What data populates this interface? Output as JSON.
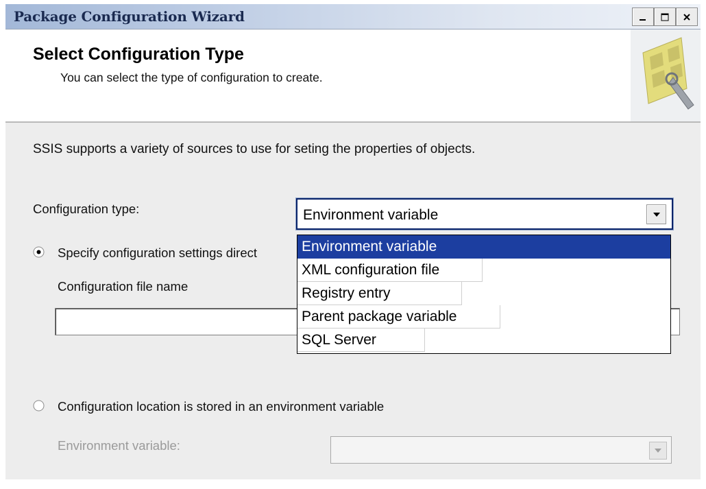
{
  "window": {
    "title": "Package Configuration Wizard"
  },
  "header": {
    "title": "Select Configuration Type",
    "subtitle": "You can select the type of configuration to create."
  },
  "body": {
    "description": "SSIS supports a variety of sources to use for seting the properties of objects.",
    "config_type_label": "Configuration type:",
    "config_type_value": "Environment variable",
    "dropdown_options": [
      "Environment variable",
      "XML configuration file",
      "Registry entry",
      "Parent package variable",
      "SQL Server"
    ],
    "radio_direct_label": "Specify configuration settings direct",
    "config_file_label": "Configuration file name",
    "config_file_value": "",
    "radio_env_label": "Configuration location is stored in an environment variable",
    "env_var_label": "Environment variable:",
    "env_var_value": ""
  },
  "state": {
    "selected_radio": "direct",
    "dropdown_open": true,
    "highlighted_option": 0
  },
  "colors": {
    "selection": "#1c3ea0",
    "titlebar_start": "#a3b8d8",
    "dialog_bg": "#ededed"
  }
}
